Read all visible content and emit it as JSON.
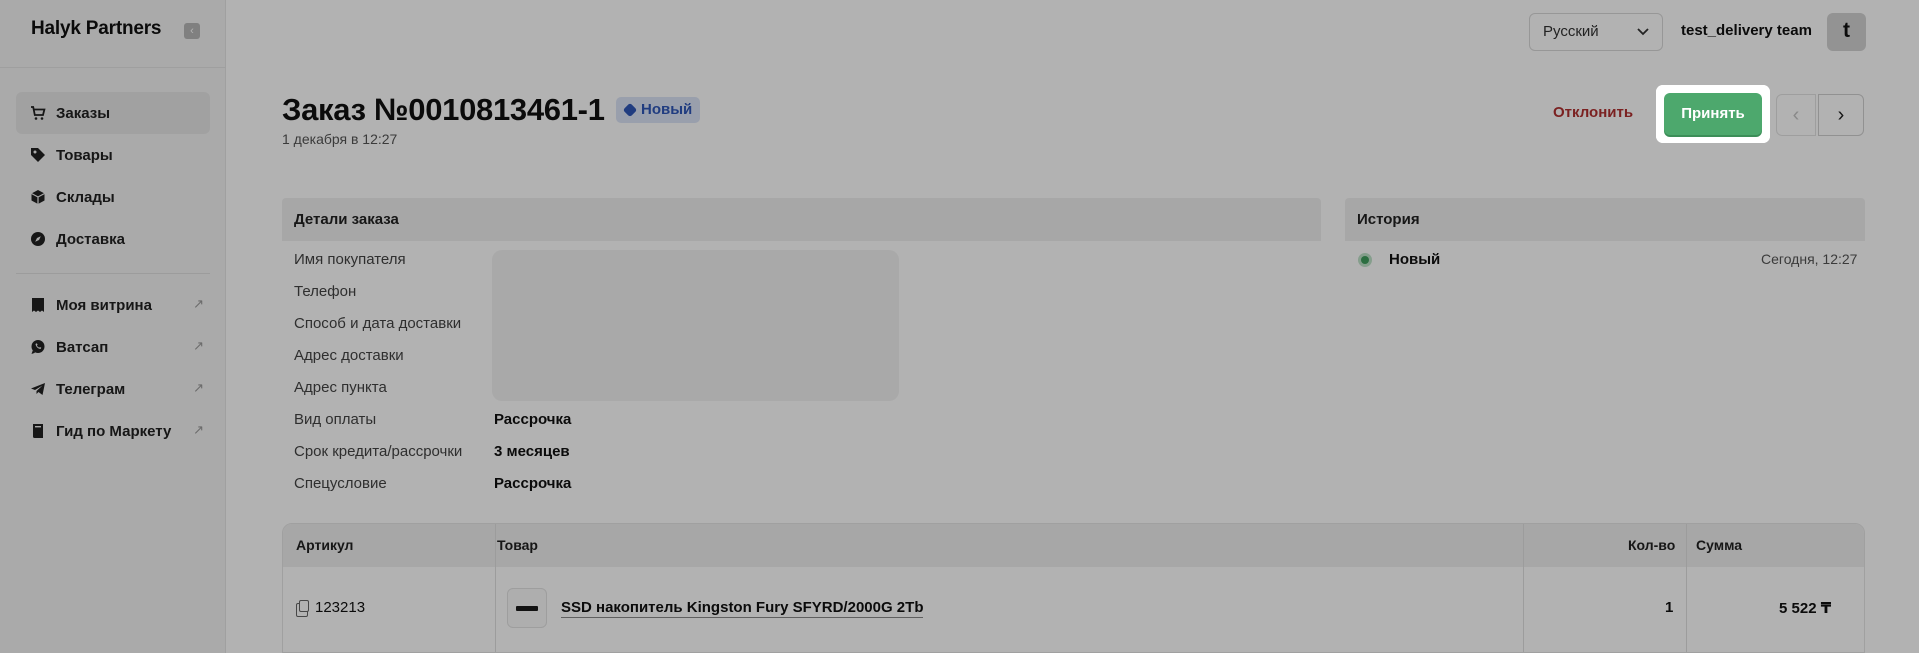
{
  "sidebar": {
    "brand": "Halyk Partners",
    "collapse_icon": "chevron-left-icon",
    "nav_main": [
      {
        "label": "Заказы",
        "icon": "cart-icon",
        "active": true
      },
      {
        "label": "Товары",
        "icon": "tag-icon",
        "active": false
      },
      {
        "label": "Склады",
        "icon": "box-icon",
        "active": false
      },
      {
        "label": "Доставка",
        "icon": "compass-icon",
        "active": false
      }
    ],
    "nav_links": [
      {
        "label": "Моя витрина",
        "icon": "storefront-icon"
      },
      {
        "label": "Ватсап",
        "icon": "whatsapp-icon"
      },
      {
        "label": "Телеграм",
        "icon": "telegram-icon"
      },
      {
        "label": "Гид по Маркету",
        "icon": "book-icon"
      }
    ]
  },
  "topbar": {
    "language": "Русский",
    "team_name": "test_delivery team",
    "avatar_letter": "t"
  },
  "order": {
    "title": "Заказ №0010813461-1",
    "status": "Новый",
    "date": "1 декабря в 12:27",
    "reject_label": "Отклонить",
    "accept_label": "Принять"
  },
  "details": {
    "heading": "Детали заказа",
    "rows": [
      {
        "label": "Имя покупателя",
        "value": ""
      },
      {
        "label": "Телефон",
        "value": ""
      },
      {
        "label": "Способ и дата доставки",
        "value": ""
      },
      {
        "label": "Адрес доставки",
        "value": ""
      },
      {
        "label": "Адрес пункта",
        "value": ""
      },
      {
        "label": "Вид оплаты",
        "value": "Рассрочка"
      },
      {
        "label": "Срок кредита/рассрочки",
        "value": "3 месяцев"
      },
      {
        "label": "Спецусловие",
        "value": "Рассрочка"
      }
    ]
  },
  "history": {
    "heading": "История",
    "entries": [
      {
        "status": "Новый",
        "time": "Сегодня, 12:27",
        "color": "#3f9e5e"
      }
    ]
  },
  "items_table": {
    "columns": [
      "Артикул",
      "Товар",
      "Кол-во",
      "Сумма"
    ],
    "rows": [
      {
        "sku": "123213",
        "product": "SSD накопитель Kingston Fury SFYRD/2000G 2Tb",
        "qty": "1",
        "sum": "5 522 ₸"
      }
    ]
  },
  "colors": {
    "accent_green": "#4da86d",
    "reject_red": "#b03030",
    "badge_blue": "#2f57b8"
  }
}
